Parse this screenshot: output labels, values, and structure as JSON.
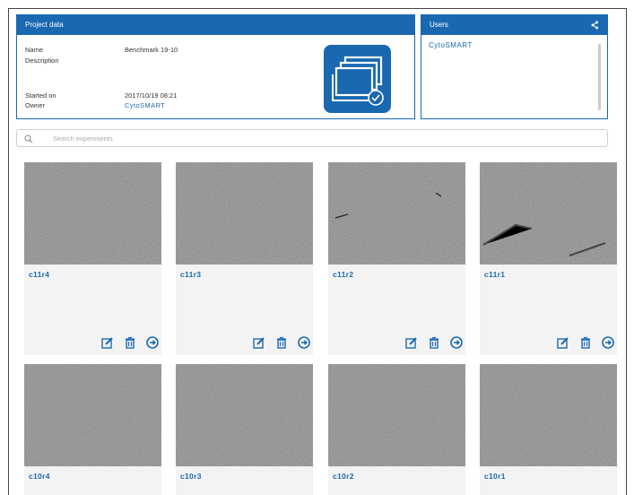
{
  "project_panel": {
    "title": "Project data",
    "name_label": "Name",
    "name_value": "Benchmark 19-10",
    "description_label": "Description",
    "description_value": "",
    "started_label": "Started on",
    "started_value": "2017/10/19 08:21",
    "owner_label": "Owner",
    "owner_value": "CytoSMART"
  },
  "users_panel": {
    "title": "Users",
    "users": [
      "CytoSMART"
    ]
  },
  "search": {
    "placeholder": "Search experiments"
  },
  "experiments": [
    {
      "name": "c11r4"
    },
    {
      "name": "c11r3"
    },
    {
      "name": "c11r2"
    },
    {
      "name": "c11r1"
    },
    {
      "name": "c10r4"
    },
    {
      "name": "c10r3"
    },
    {
      "name": "c10r2"
    },
    {
      "name": "c10r1"
    }
  ],
  "colors": {
    "accent": "#1a68b0",
    "card_bg": "#f3f3f3"
  },
  "icons": {
    "edit": "edit-icon",
    "delete": "trash-icon",
    "open": "arrow-right-circle-icon",
    "search": "search-icon",
    "share": "share-icon"
  }
}
